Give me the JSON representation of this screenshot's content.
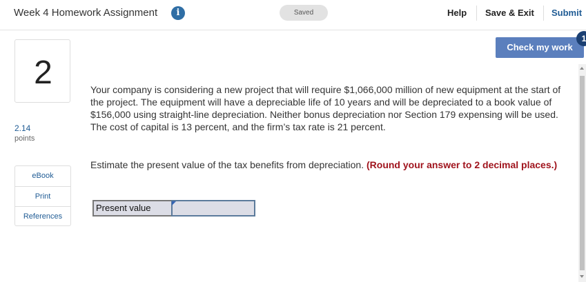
{
  "header": {
    "title": "Week 4 Homework Assignment",
    "info_icon": "i",
    "status": "Saved",
    "help_label": "Help",
    "save_exit_label": "Save & Exit",
    "submit_label": "Submit"
  },
  "check_button": {
    "label": "Check my work",
    "badge": "1"
  },
  "question": {
    "number": "2",
    "points_value": "2.14",
    "points_label": "points",
    "text": "Your company is considering a new project that will require $1,066,000 million of new equipment at the start of the project. The equipment will have a depreciable life of 10 years and will be depreciated to a book value of $156,000 using straight-line depreciation. Neither bonus depreciation nor Section 179 expensing will be used. The cost of capital is 13 percent, and the firm’s tax rate is 21 percent.",
    "instruction": "Estimate the present value of the tax benefits from depreciation.",
    "round_note": "(Round your answer to 2 decimal places.)"
  },
  "resources": [
    "eBook",
    "Print",
    "References"
  ],
  "answer": {
    "label": "Present value",
    "value": ""
  },
  "colors": {
    "accent": "#5b7fbd",
    "submit": "#1f5b94",
    "round_note": "#a0141d",
    "info_icon": "#2f6ea5"
  }
}
